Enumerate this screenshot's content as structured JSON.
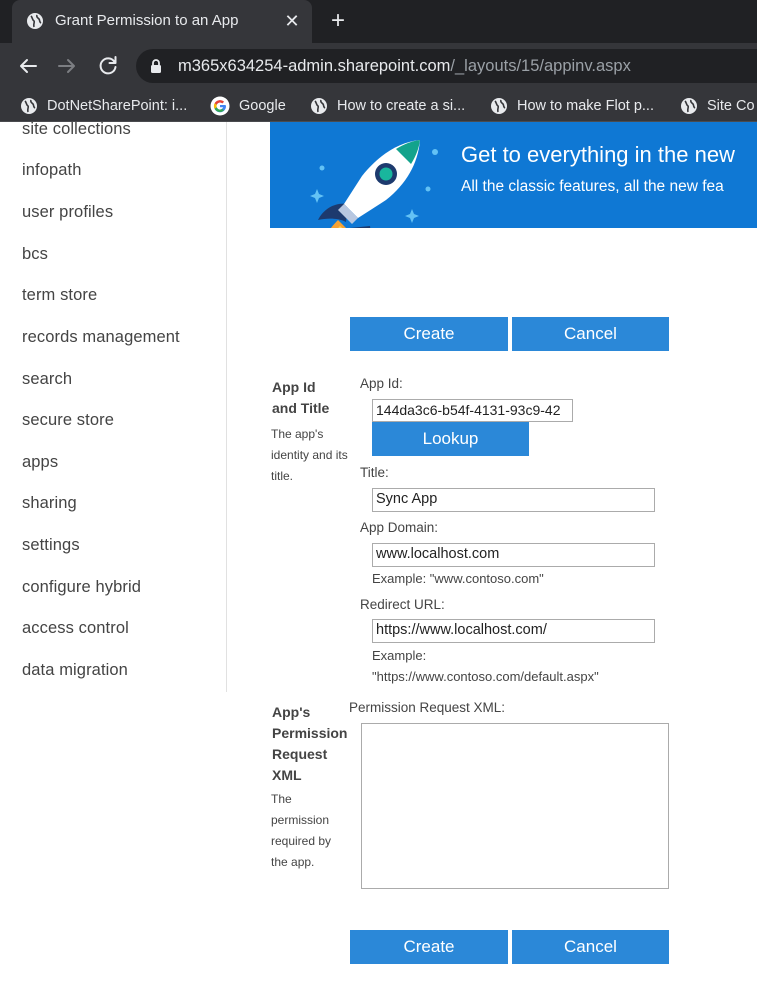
{
  "browser": {
    "tab_title": "Grant Permission to an App",
    "url_host": "m365x634254-admin.sharepoint.com",
    "url_path": "/_layouts/15/appinv.aspx",
    "bookmarks": [
      {
        "label": "DotNetSharePoint: i...",
        "icon": "globe-icon"
      },
      {
        "label": "Google",
        "icon": "google-icon"
      },
      {
        "label": "How to create a si...",
        "icon": "globe-icon"
      },
      {
        "label": "How to make Flot p...",
        "icon": "globe-icon"
      },
      {
        "label": "Site Co",
        "icon": "globe-icon"
      }
    ]
  },
  "left_nav": {
    "items": [
      "site collections",
      "infopath",
      "user profiles",
      "bcs",
      "term store",
      "records management",
      "search",
      "secure store",
      "apps",
      "sharing",
      "settings",
      "configure hybrid",
      "access control",
      "data migration"
    ]
  },
  "banner": {
    "title": "Get to everything in the new",
    "subtitle": "All the classic features, all the new fea"
  },
  "form": {
    "create_label": "Create",
    "cancel_label": "Cancel",
    "lookup_label": "Lookup",
    "app_id_section": {
      "title": "App Id and Title",
      "description": "The app's identity and its title."
    },
    "app_id_label": "App Id:",
    "app_id_value": "144da3c6-b54f-4131-93c9-42",
    "title_label": "Title:",
    "title_value": "Sync App",
    "app_domain_label": "App Domain:",
    "app_domain_value": "www.localhost.com",
    "app_domain_example": "Example: \"www.contoso.com\"",
    "redirect_label": "Redirect URL:",
    "redirect_value": "https://www.localhost.com/",
    "redirect_example_1": "Example:",
    "redirect_example_2": "\"https://www.contoso.com/default.aspx\"",
    "permission_section": {
      "title": "App's Permission Request XML",
      "description": "The permission required by the app."
    },
    "permission_label": "Permission Request XML:",
    "permission_value": ""
  },
  "colors": {
    "accent_button": "#2b88d8",
    "banner": "#0f78d4"
  }
}
